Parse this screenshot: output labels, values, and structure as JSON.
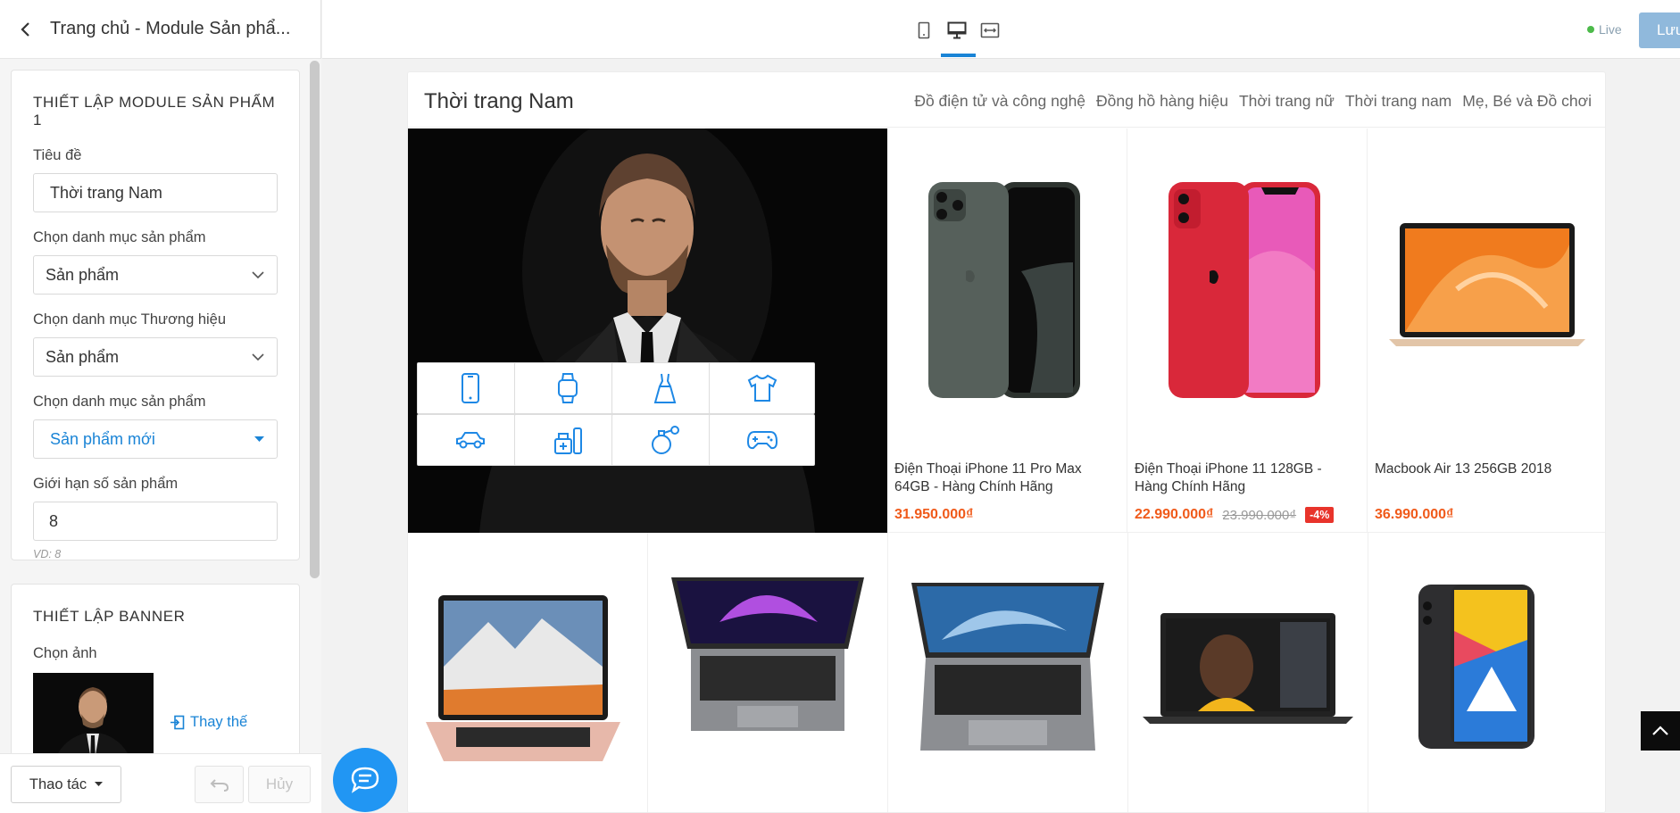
{
  "sidebar": {
    "header_title": "Trang chủ - Module Sản phẩ...",
    "module_panel": {
      "title": "THIẾT LẬP MODULE SẢN PHẨM 1",
      "title_label": "Tiêu đề",
      "title_value": "Thời trang Nam",
      "category_label": "Chọn danh mục sản phẩm",
      "category_value": "Sản phẩm",
      "brand_label": "Chọn danh mục Thương hiệu",
      "brand_value": "Sản phẩm",
      "category2_label": "Chọn danh mục sản phẩm",
      "category2_value": "Sản phẩm mới",
      "limit_label": "Giới hạn số sản phẩm",
      "limit_value": "8",
      "limit_hint": "VD: 8"
    },
    "banner_panel": {
      "title": "THIẾT LẬP BANNER",
      "image_label": "Chọn ảnh",
      "replace_label": "Thay thế"
    },
    "footer": {
      "action_label": "Thao tác",
      "cancel_label": "Hủy"
    }
  },
  "topbar": {
    "live_label": "Live",
    "save_label": "Lưu"
  },
  "module": {
    "title": "Thời trang Nam",
    "nav": [
      "Đồ điện tử và công nghệ",
      "Đồng hồ hàng hiệu",
      "Thời trang nữ",
      "Thời trang nam",
      "Mẹ, Bé và Đồ chơi"
    ],
    "category_icons": [
      "phone-icon",
      "watch-icon",
      "dress-icon",
      "shirt-icon",
      "car-icon",
      "cosmetics-icon",
      "perfume-icon",
      "gamepad-icon"
    ],
    "products": [
      {
        "name": "Điện Thoại iPhone 11 Pro Max 64GB - Hàng Chính Hãng",
        "price": "31.950.000₫",
        "old_price": "",
        "discount": ""
      },
      {
        "name": "Điện Thoại iPhone 11 128GB - Hàng Chính Hãng",
        "price": "22.990.000₫",
        "old_price": "23.990.000₫",
        "discount": "-4%"
      },
      {
        "name": "Macbook Air 13 256GB 2018",
        "price": "36.990.000₫",
        "old_price": "",
        "discount": ""
      }
    ]
  },
  "colors": {
    "accent": "#1a84d6",
    "price": "#f05a1a",
    "discount": "#e8342b",
    "live": "#4cba4a"
  }
}
